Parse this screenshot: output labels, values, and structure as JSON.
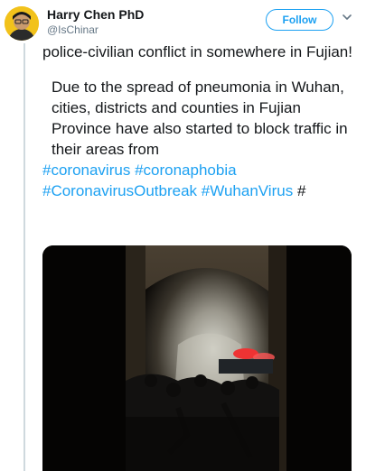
{
  "author": {
    "name": "Harry Chen PhD",
    "handle": "@IsChinar",
    "avatar_icon": "avatar-icon"
  },
  "actions": {
    "follow_label": "Follow",
    "more_icon": "chevron-down-icon"
  },
  "tweet": {
    "paragraph1": "police-civilian conflict in somewhere in Fujian!",
    "paragraph2": "Due to the spread of pneumonia in Wuhan, cities, districts and counties in Fujian Province have also started to block traffic in their areas from",
    "hashtags": [
      "#coronavirus",
      "#coronaphobia",
      "#CoronavirusOutbreak",
      "#WuhanVirus"
    ],
    "hashtag_tail": "#"
  },
  "colors": {
    "accent": "#1da1f2",
    "text": "#14171a",
    "muted": "#657786"
  }
}
